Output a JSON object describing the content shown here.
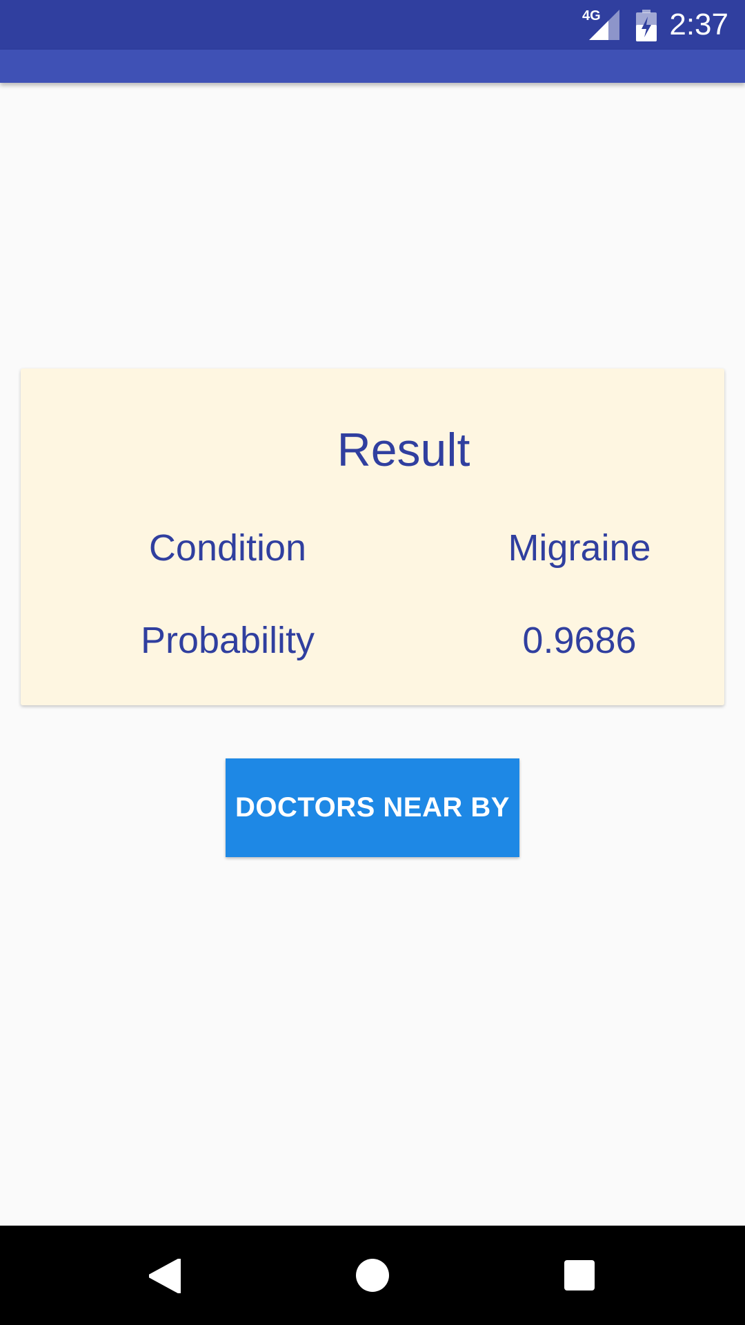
{
  "status_bar": {
    "time": "2:37",
    "network_type": "4G",
    "background_color": "#303f9f"
  },
  "app_bar": {
    "background_color": "#3f51b5"
  },
  "result_card": {
    "title": "Result",
    "background_color": "#fef6e1",
    "text_color": "#303f9f",
    "rows": [
      {
        "label": "Condition",
        "value": "Migraine"
      },
      {
        "label": "Probability",
        "value": "0.9686"
      }
    ]
  },
  "actions": {
    "doctors_button_label": "DOCTORS NEAR BY",
    "button_color": "#1e88e5"
  },
  "nav_bar": {
    "icons": [
      "back-icon",
      "home-icon",
      "recents-icon"
    ]
  }
}
